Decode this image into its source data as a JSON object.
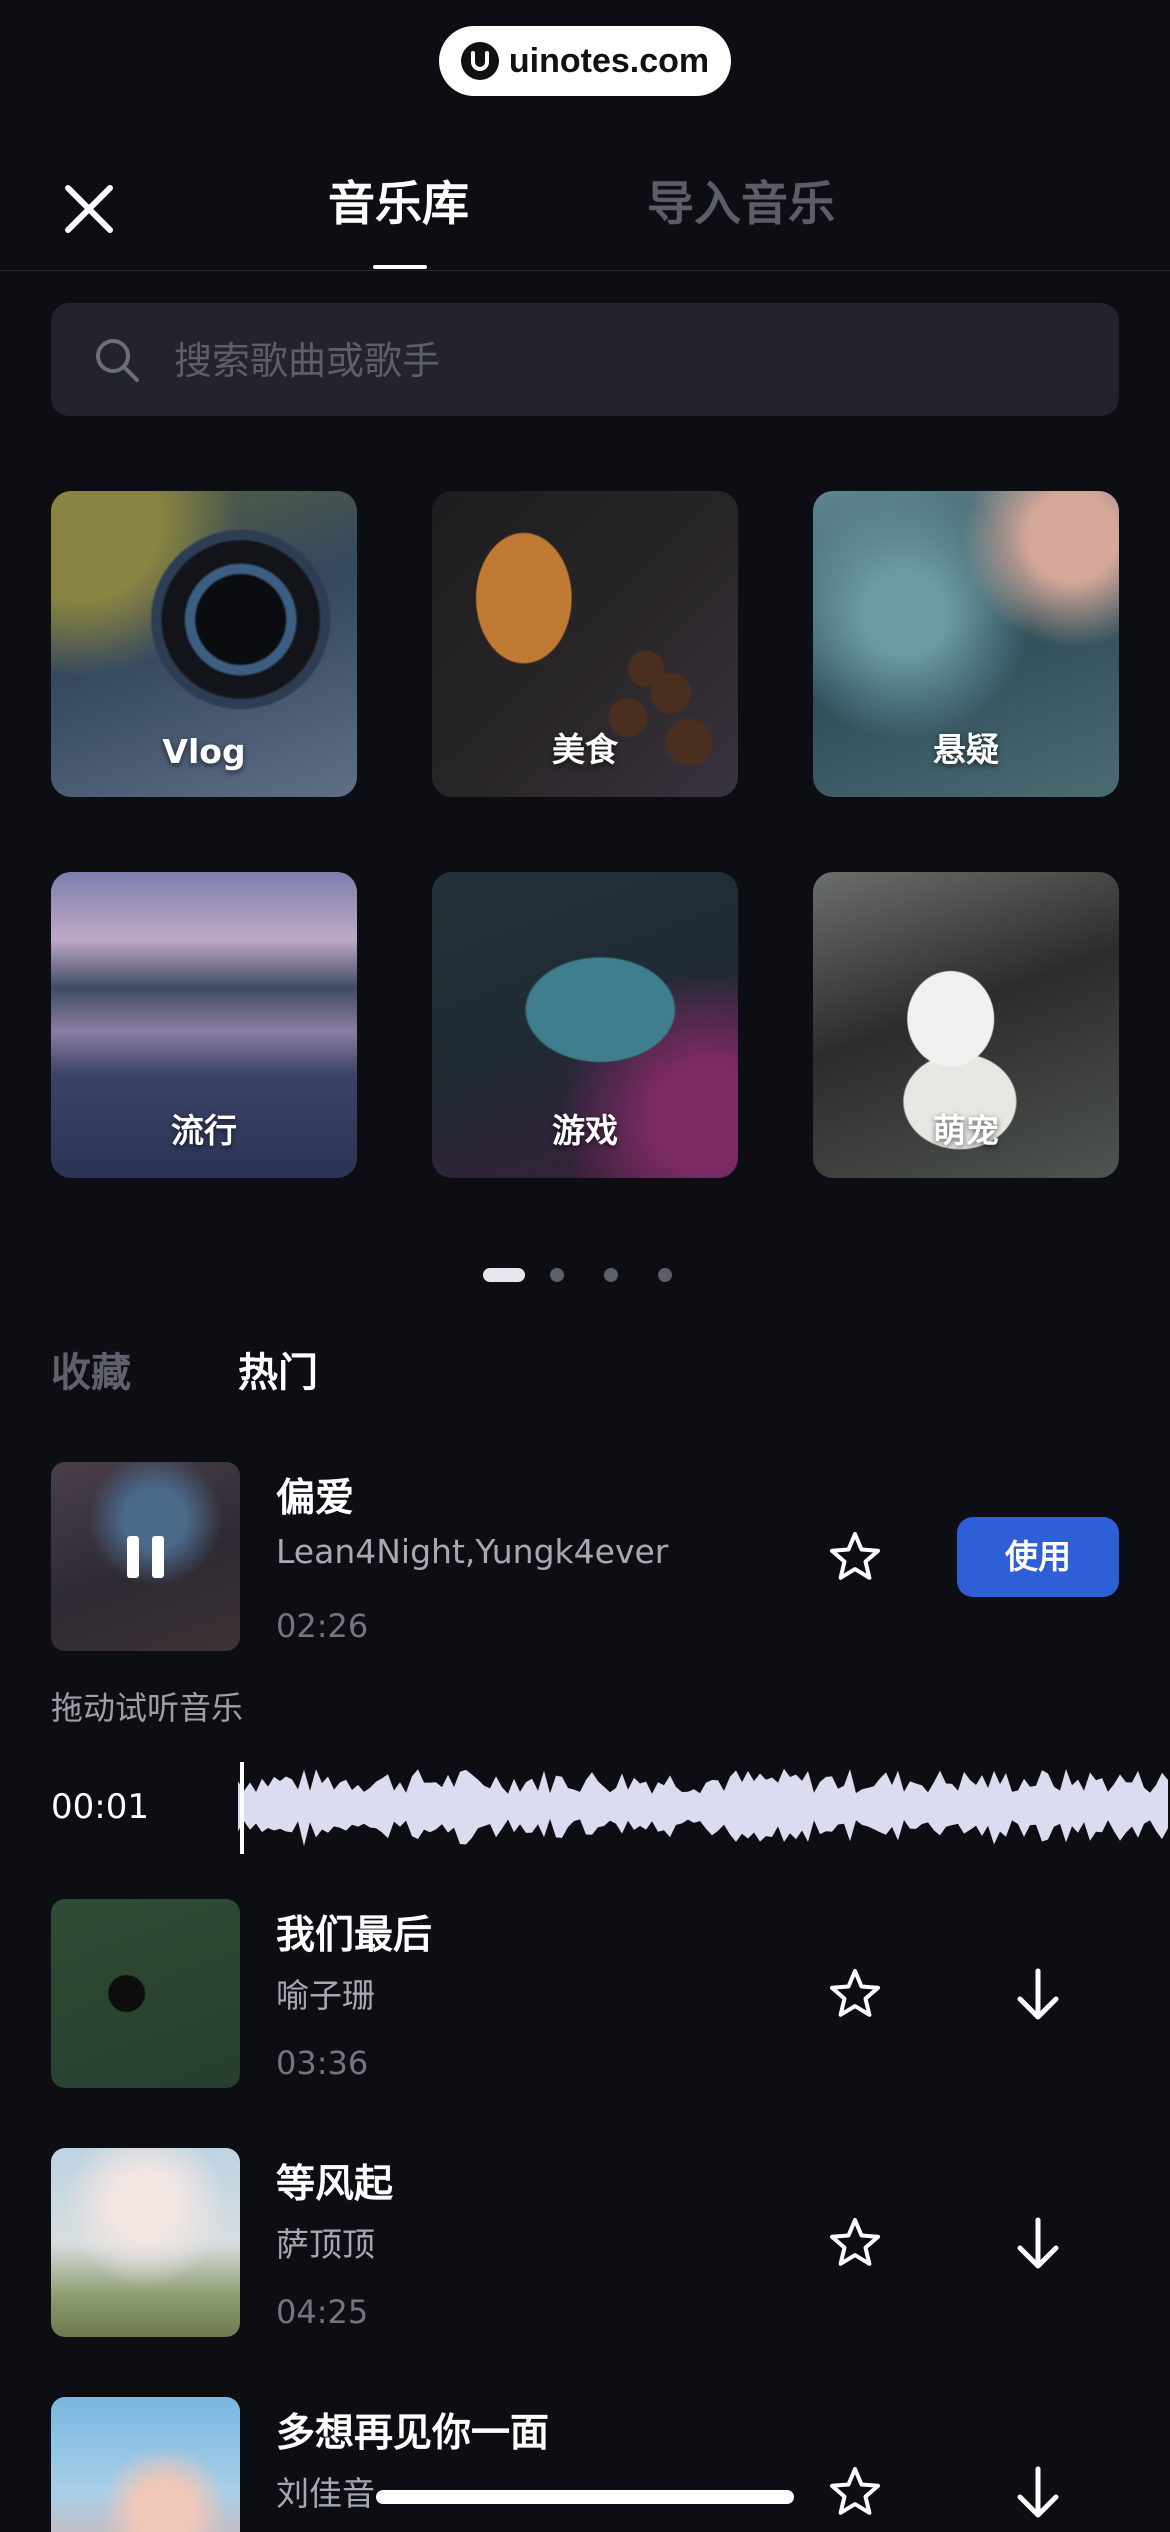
{
  "watermark": {
    "text": "uinotes.com"
  },
  "header": {
    "tabs": [
      {
        "label": "音乐库",
        "active": true
      },
      {
        "label": "导入音乐",
        "active": false
      }
    ]
  },
  "search": {
    "placeholder": "搜索歌曲或歌手"
  },
  "categories": [
    {
      "label": "Vlog"
    },
    {
      "label": "美食"
    },
    {
      "label": "悬疑"
    },
    {
      "label": "流行"
    },
    {
      "label": "游戏"
    },
    {
      "label": "萌宠"
    }
  ],
  "pager": {
    "pages": 4,
    "current": 1
  },
  "sections": [
    {
      "label": "收藏",
      "active": false
    },
    {
      "label": "热门",
      "active": true
    }
  ],
  "songs": [
    {
      "title": "偏爱",
      "artist": "Lean4Night,Yungk4ever",
      "duration": "02:26",
      "action": "使用",
      "playing": true
    },
    {
      "title": "我们最后",
      "artist": "喻子珊",
      "duration": "03:36"
    },
    {
      "title": "等风起",
      "artist": "萨顶顶",
      "duration": "04:25"
    },
    {
      "title": "多想再见你一面",
      "artist": "刘佳音"
    }
  ],
  "player": {
    "hint": "拖动试听音乐",
    "current_time": "00:01"
  },
  "colors": {
    "background": "#0d0e14",
    "accent": "#2f5fd6",
    "waveform": "#dcdcf0"
  }
}
